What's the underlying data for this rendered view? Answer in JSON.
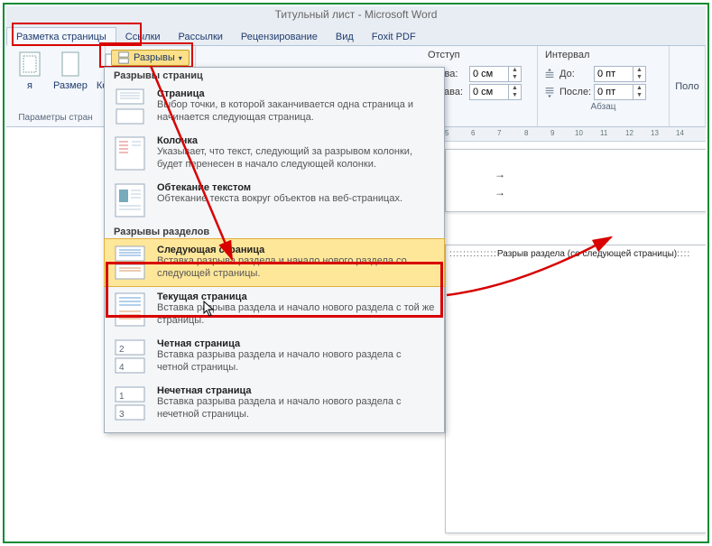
{
  "window_title": "Титульный лист - Microsoft Word",
  "tabs": {
    "page_layout": "Разметка страницы",
    "references": "Ссылки",
    "mailings": "Рассылки",
    "review": "Рецензирование",
    "view": "Вид",
    "foxit": "Foxit PDF"
  },
  "ribbon": {
    "margins_btn": "я",
    "size_btn": "Размер",
    "columns_btn": "Колонки",
    "breaks_btn": "Разрывы",
    "page_params_footer": "Параметры стран",
    "indent_header": "Отступ",
    "left_label": "Слева:",
    "right_label": "Справа:",
    "left_value": "0 см",
    "right_value": "0 см",
    "interval_header": "Интервал",
    "before_label": "До:",
    "after_label": "После:",
    "before_value": "0 пт",
    "after_value": "0 пт",
    "paragraph_footer": "Абзац",
    "pos_trunc": "Поло"
  },
  "dropdown": {
    "section1": "Разрывы страниц",
    "page": {
      "title": "Страница",
      "desc": "Выбор точки, в которой заканчивается одна страница и начинается следующая страница."
    },
    "column": {
      "title": "Колонка",
      "desc": "Указывает, что текст, следующий за разрывом колонки, будет перенесен в начало следующей колонки."
    },
    "textwrap": {
      "title": "Обтекание текстом",
      "desc": "Обтекание текста вокруг объектов на веб-страницах."
    },
    "section2": "Разрывы разделов",
    "nextpage": {
      "title": "Следующая страница",
      "desc": "Вставка разрыва раздела и начало нового раздела со следующей страницы."
    },
    "continuous": {
      "title": "Текущая страница",
      "desc": "Вставка разрыва раздела и начало нового раздела с той же страницы."
    },
    "evenpage": {
      "title": "Четная страница",
      "desc": "Вставка разрыва раздела и начало нового раздела с четной страницы."
    },
    "oddpage": {
      "title": "Нечетная страница",
      "desc": "Вставка разрыва раздела и начало нового раздела с нечетной страницы."
    }
  },
  "ruler_marks": [
    "5",
    "6",
    "7",
    "8",
    "9",
    "10",
    "11",
    "12",
    "13",
    "14"
  ],
  "section_break_label": "Разрыв раздела (со следующей страницы)"
}
